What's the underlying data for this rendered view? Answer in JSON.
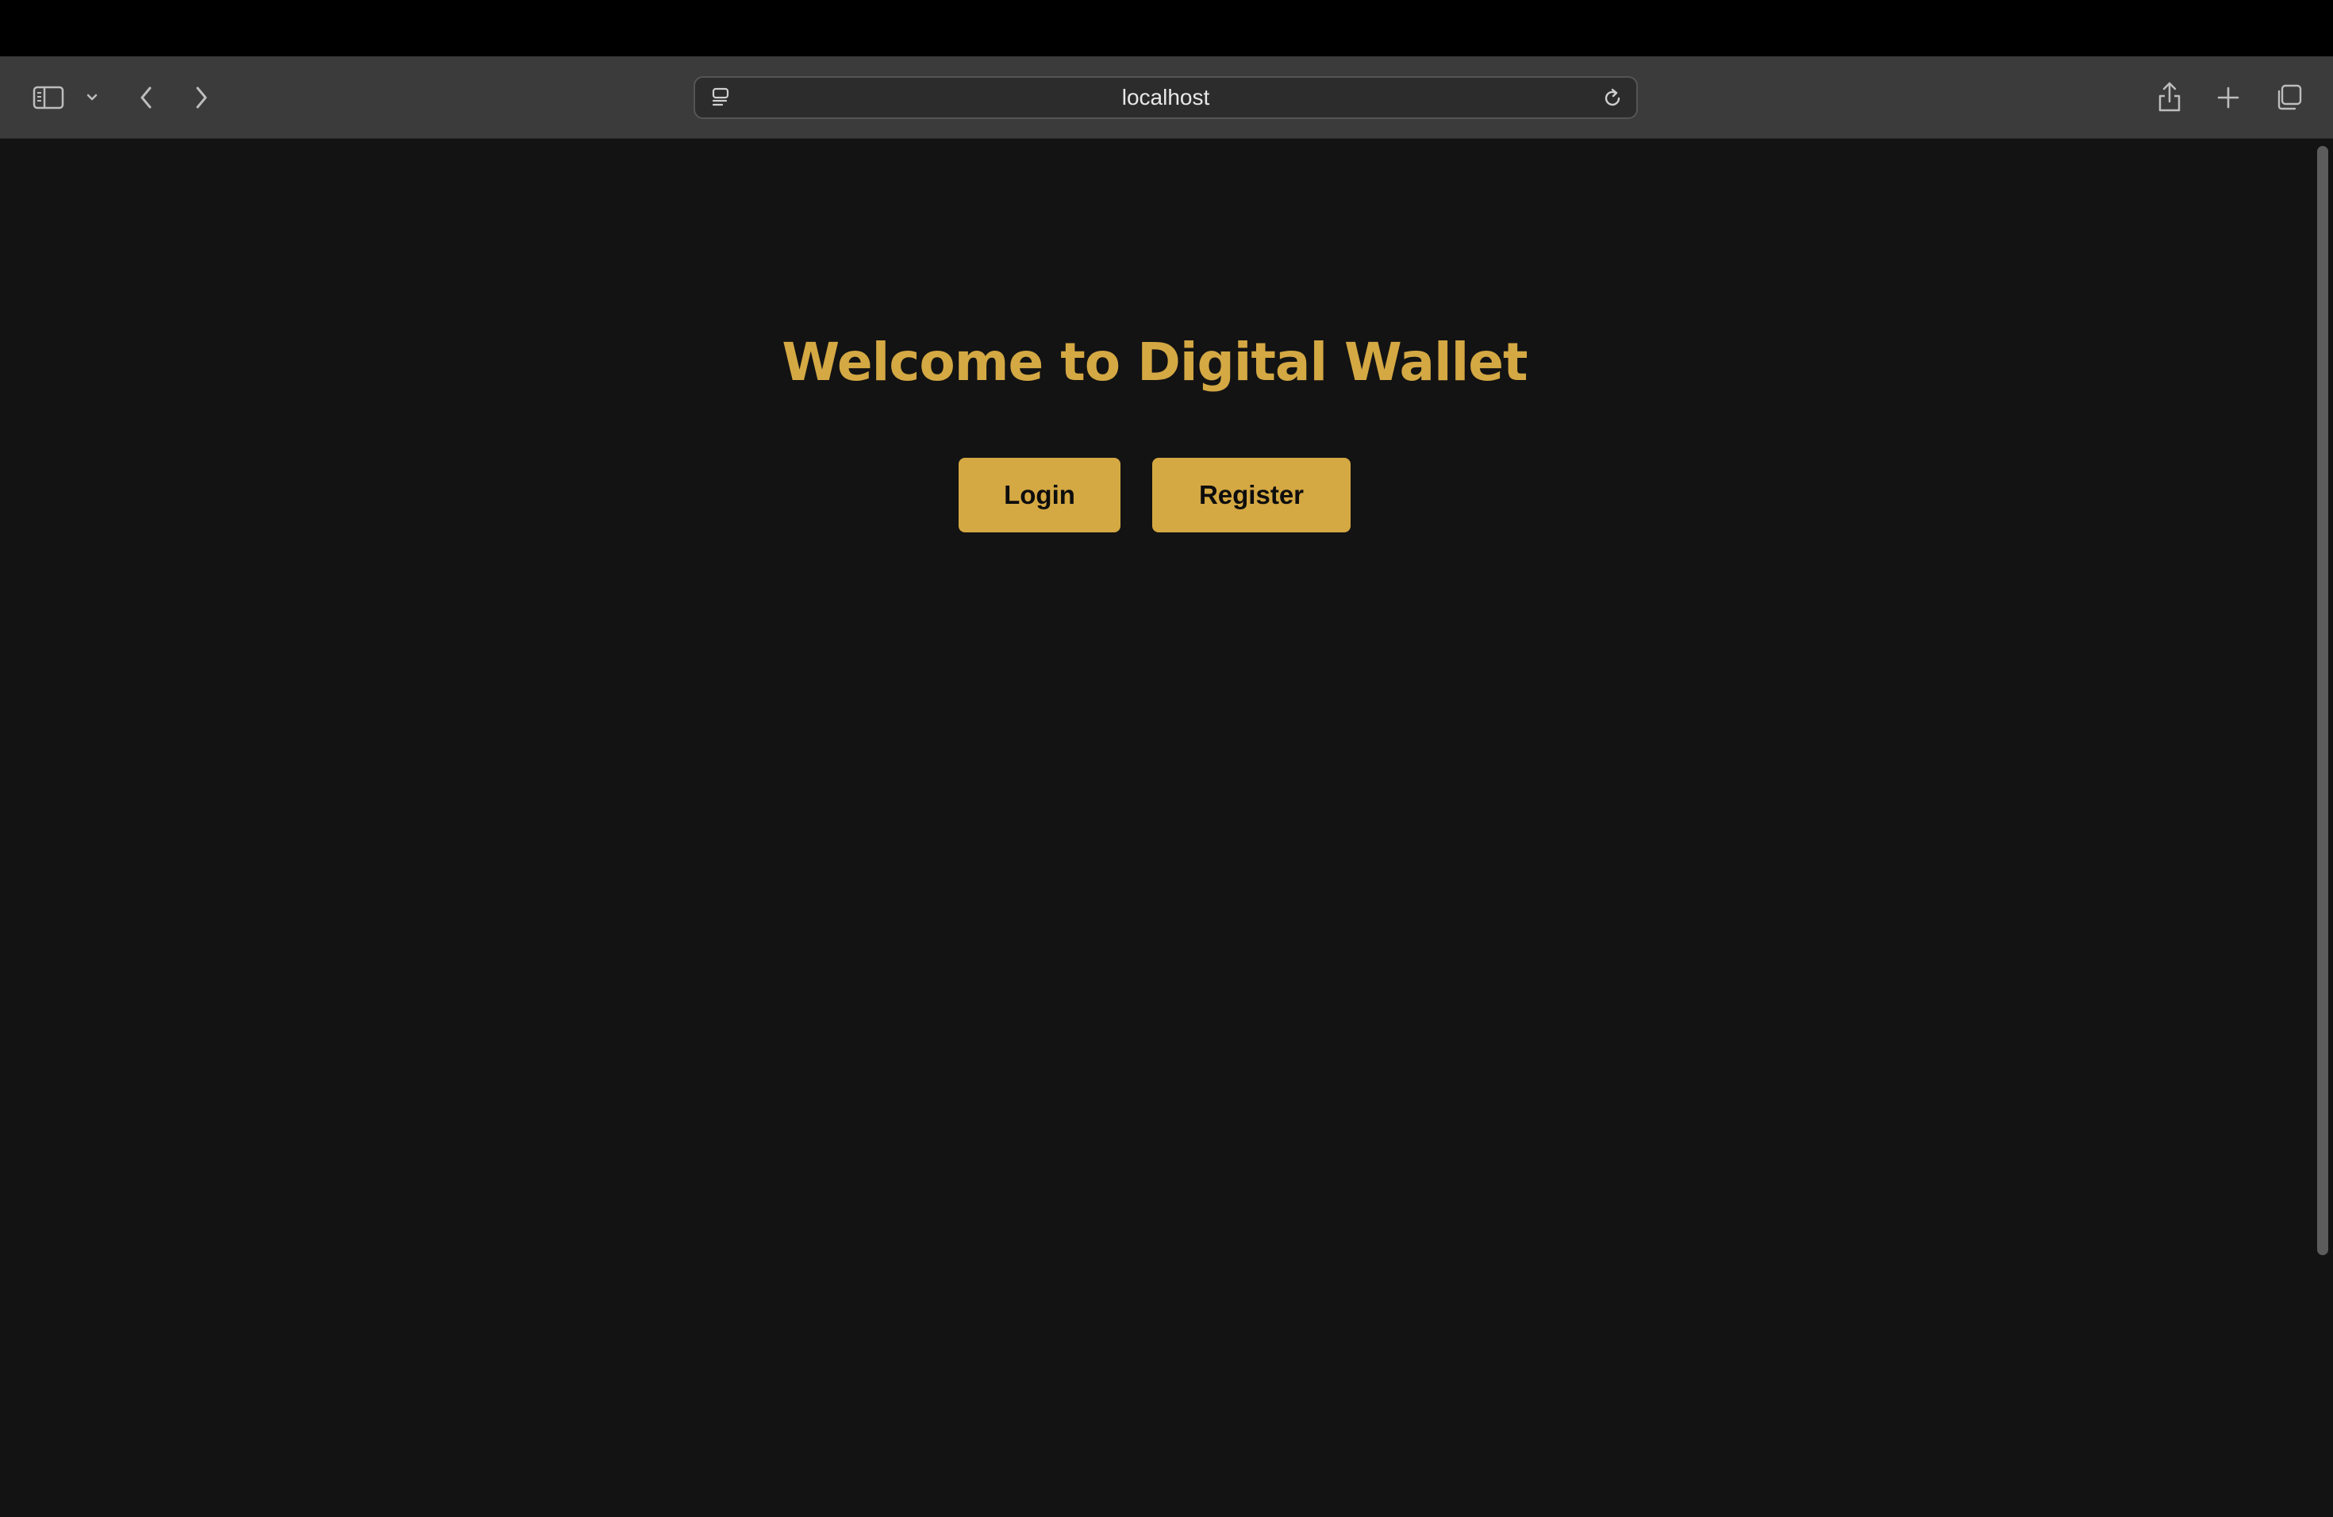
{
  "browser": {
    "url": "localhost",
    "icons": {
      "sidebar": "sidebar-icon",
      "sidebar_menu": "chevron-down-icon",
      "back": "chevron-left-icon",
      "forward": "chevron-right-icon",
      "site": "site-settings-icon",
      "reload": "reload-icon",
      "share": "share-icon",
      "new_tab": "plus-icon",
      "tab_overview": "tab-overview-icon"
    }
  },
  "page": {
    "title": "Welcome to Digital Wallet",
    "buttons": {
      "login": "Login",
      "register": "Register"
    }
  },
  "colors": {
    "accent": "#d4a843",
    "page_background": "#131313",
    "toolbar_background": "#3b3b3b",
    "button_text": "#0d0d0d"
  }
}
